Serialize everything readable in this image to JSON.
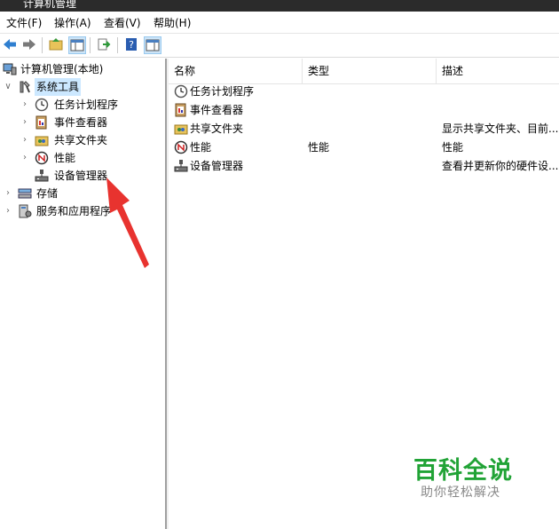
{
  "window": {
    "title": "计算机管理"
  },
  "menu": [
    {
      "key": "file",
      "label": "文件(F)"
    },
    {
      "key": "action",
      "label": "操作(A)"
    },
    {
      "key": "view",
      "label": "查看(V)"
    },
    {
      "key": "help",
      "label": "帮助(H)"
    }
  ],
  "toolbar": {
    "buttons": [
      "back-arrow-icon",
      "forward-arrow-icon",
      "up-folder-icon",
      "show-tree-icon",
      "export-list-icon",
      "help-icon",
      "action-pane-icon"
    ]
  },
  "tree": {
    "root": "计算机管理(本地)",
    "system_tools": "系统工具",
    "task_scheduler": "任务计划程序",
    "event_viewer": "事件查看器",
    "shared_folders": "共享文件夹",
    "performance": "性能",
    "device_manager": "设备管理器",
    "storage": "存储",
    "services_apps": "服务和应用程序"
  },
  "list": {
    "columns": [
      "名称",
      "类型",
      "描述"
    ],
    "rows": [
      {
        "name": "任务计划程序",
        "type": "",
        "desc": ""
      },
      {
        "name": "事件查看器",
        "type": "",
        "desc": ""
      },
      {
        "name": "共享文件夹",
        "type": "",
        "desc": "显示共享文件夹、目前..."
      },
      {
        "name": "性能",
        "type": "性能",
        "desc": "性能"
      },
      {
        "name": "设备管理器",
        "type": "",
        "desc": "查看并更新你的硬件设..."
      }
    ]
  },
  "watermark": {
    "title": "百科全说",
    "subtitle": "助你轻松解决"
  },
  "colors": {
    "selection": "#cce8ff",
    "arrow": "#e8332f",
    "watermark_green": "#21a336"
  }
}
